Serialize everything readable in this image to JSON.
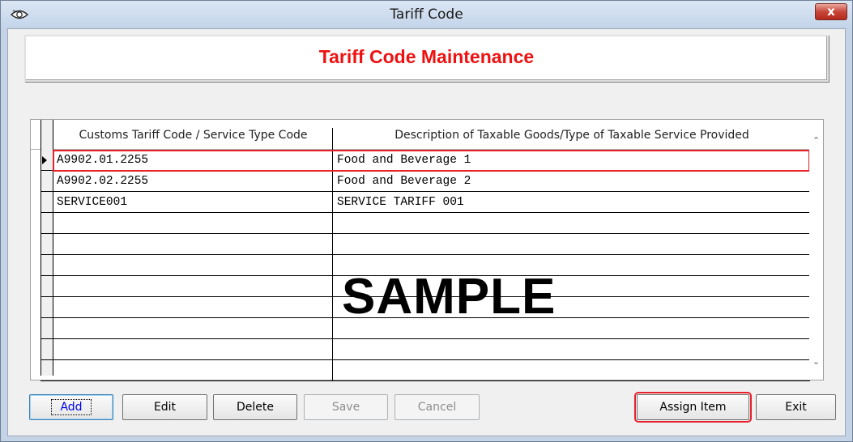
{
  "window": {
    "title": "Tariff Code",
    "close_label": "x"
  },
  "header": {
    "title": "Tariff Code Maintenance"
  },
  "grid": {
    "columns": [
      "Customs Tariff Code / Service Type Code",
      "Description of Taxable Goods/Type of Taxable Service Provided"
    ],
    "rows": [
      {
        "code": "A9902.01.2255",
        "description": "Food and Beverage 1"
      },
      {
        "code": "A9902.02.2255",
        "description": "Food and Beverage 2"
      },
      {
        "code": "SERVICE001",
        "description": "SERVICE TARIFF 001"
      },
      {
        "code": "",
        "description": ""
      },
      {
        "code": "",
        "description": ""
      },
      {
        "code": "",
        "description": ""
      },
      {
        "code": "",
        "description": ""
      },
      {
        "code": "",
        "description": ""
      },
      {
        "code": "",
        "description": ""
      },
      {
        "code": "",
        "description": ""
      },
      {
        "code": "",
        "description": ""
      }
    ],
    "selected_row": 0,
    "watermark": "SAMPLE"
  },
  "buttons": {
    "add": "Add",
    "edit": "Edit",
    "delete": "Delete",
    "save": "Save",
    "cancel": "Cancel",
    "assign_item": "Assign Item",
    "exit": "Exit"
  },
  "icons": {
    "app": "eye-icon",
    "scroll_up": "chevron-up-icon",
    "scroll_down": "chevron-down-icon",
    "row_indicator": "triangle-right-icon"
  },
  "colors": {
    "accent_red": "#ee1111",
    "highlight_red": "#e8202a"
  }
}
